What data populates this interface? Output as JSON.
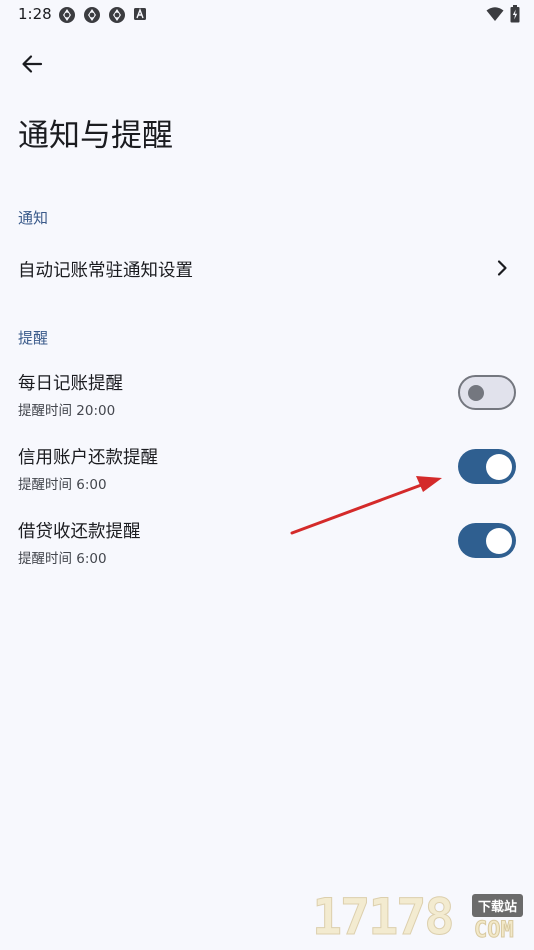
{
  "status_bar": {
    "time": "1:28",
    "left_icons": [
      "sync-icon",
      "sync-icon",
      "sync-icon",
      "a-badge-icon"
    ],
    "right_icons": [
      "wifi-icon",
      "battery-charging-icon"
    ]
  },
  "header": {
    "back_icon": "arrow-back-icon",
    "title": "通知与提醒"
  },
  "sections": {
    "notification": {
      "header": "通知",
      "items": [
        {
          "title": "自动记账常驻通知设置",
          "trailing_icon": "chevron-right-icon"
        }
      ]
    },
    "reminder": {
      "header": "提醒",
      "items": [
        {
          "title": "每日记账提醒",
          "subtitle": "提醒时间 20:00",
          "enabled": false
        },
        {
          "title": "信用账户还款提醒",
          "subtitle": "提醒时间 6:00",
          "enabled": true
        },
        {
          "title": "借贷收还款提醒",
          "subtitle": "提醒时间 6:00",
          "enabled": true
        }
      ]
    }
  },
  "annotation": {
    "arrow_color": "#d42a2a"
  },
  "watermark": {
    "digits": "17178",
    "badge": "下载站",
    "suffix": "COM"
  },
  "colors": {
    "background": "#f7f8fd",
    "accent": "#2f5f90",
    "section_header": "#3a5a8a",
    "toggle_off_track": "#e1e2ec",
    "toggle_off_outline": "#74777f"
  }
}
